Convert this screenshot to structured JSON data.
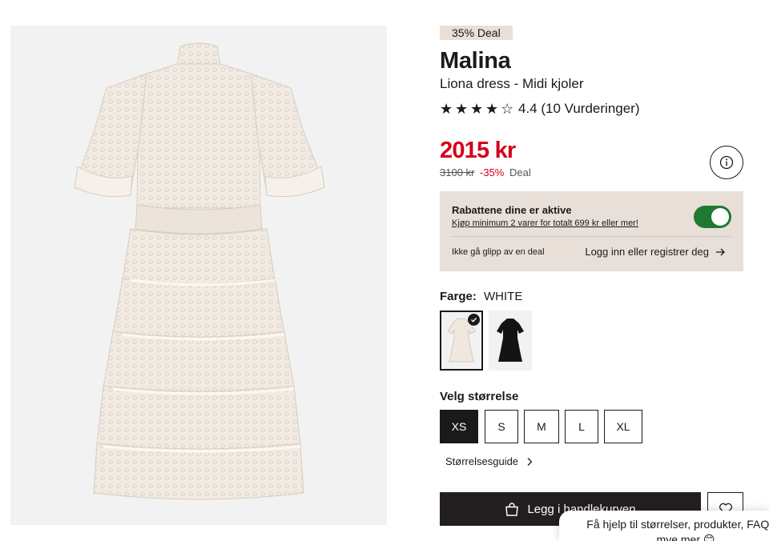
{
  "product": {
    "deal_badge": "35% Deal",
    "brand": "Malina",
    "subtitle": "Liona dress - Midi kjoler",
    "rating": {
      "stars_filled": 4,
      "stars_total": 5,
      "text": "4.4 (10 Vurderinger)"
    },
    "price": "2015 kr",
    "old_price": "3100 kr",
    "discount_pct": "-35%",
    "deal_word": "Deal"
  },
  "discount_box": {
    "title": "Rabattene dine er aktive",
    "link": "Kjøp minimum 2 varer for totalt 699 kr eller mer!",
    "toggle_on": true,
    "miss_text": "Ikke gå glipp av en deal",
    "login_text": "Logg inn eller registrer deg"
  },
  "color": {
    "label": "Farge:",
    "value": "WHITE"
  },
  "size": {
    "label": "Velg størrelse",
    "options": [
      "XS",
      "S",
      "M",
      "L",
      "XL"
    ],
    "selected": "XS",
    "guide": "Størrelsesguide"
  },
  "cart": {
    "add_label": "Legg i handlekurven"
  },
  "chat": {
    "text": "Få hjelp til størrelser, produkter, FAQ og mye mer 😊"
  },
  "colors": {
    "price_red": "#d4001a",
    "badge_bg": "#e8dfd8",
    "toggle_green": "#1f7a30",
    "cart_button": "#231f20"
  },
  "icons": {
    "star": "star-icon",
    "info": "info-icon",
    "arrow": "arrow-right-icon",
    "chevron": "chevron-right-icon",
    "bag": "shopping-bag-icon",
    "heart": "heart-icon",
    "check": "checkmark-icon"
  }
}
